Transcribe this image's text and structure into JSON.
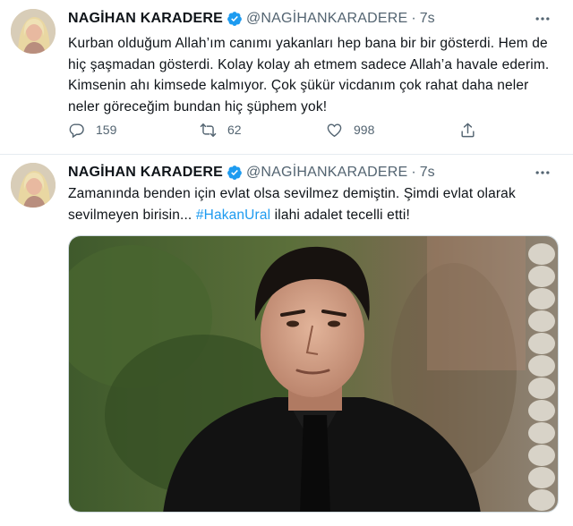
{
  "tweets": [
    {
      "author_name": "NAGİHAN KARADERE",
      "handle": "@NAGİHANKARADERE",
      "separator": "·",
      "time": "7s",
      "text": "Kurban olduğum Allah’ım canımı yakanları hep bana bir bir gösterdi. Hem de hiç şaşmadan gösterdi. Kolay kolay ah etmem sadece Allah’a havale ederim. Kimsenin ahı kimsede kalmıyor. Çok şükür vicdanım çok rahat daha neler neler göreceğim bundan hiç şüphem yok!",
      "replies": "159",
      "retweets": "62",
      "likes": "998",
      "icons": [
        "more-icon",
        "reply-icon",
        "retweet-icon",
        "like-icon",
        "share-icon",
        "verified-badge-icon"
      ]
    },
    {
      "author_name": "NAGİHAN KARADERE",
      "handle": "@NAGİHANKARADERE",
      "separator": "·",
      "time": "7s",
      "text_before": "Zamanında benden için evlat olsa sevilmez demiştin. Şimdi evlat olarak sevilmeyen birisin... ",
      "hashtag": "#HakanUral",
      "text_after": " ilahi adalet tecelli etti!",
      "media": "photo"
    }
  ],
  "colors": {
    "accent": "#1d9bf0",
    "text": "#0f1419",
    "secondary": "#536471",
    "divider": "#e6ecf0"
  }
}
